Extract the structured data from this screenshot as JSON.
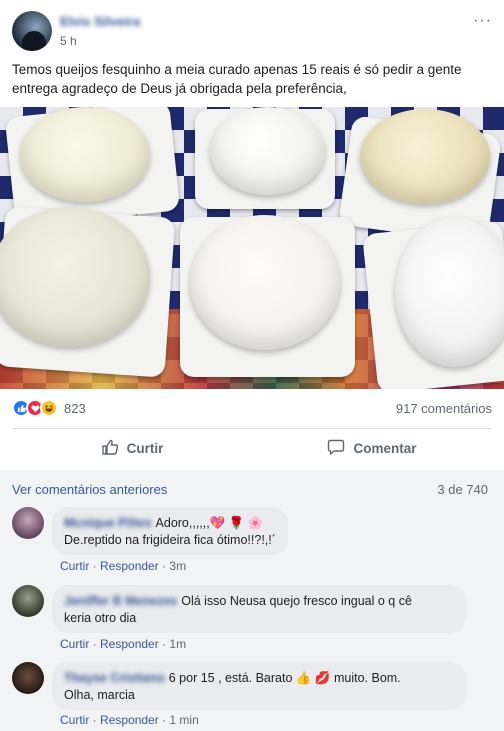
{
  "post": {
    "author_name": "Elvis Silveira",
    "time": "5 h",
    "menu_icon": "ellipsis-icon",
    "text": "Temos queijos fesquinho a meia curado apenas 15 reais é só pedir a gente entrega agradeço de Deus já obrigada pela preferência,"
  },
  "reactions": {
    "icons": [
      "like-icon",
      "love-icon",
      "haha-icon"
    ],
    "count": "823",
    "comments_count": "917 comentários"
  },
  "actions": {
    "like_label": "Curtir",
    "comment_label": "Comentar"
  },
  "comments_section": {
    "view_previous": "Ver comentários anteriores",
    "range": "3 de 740",
    "items": [
      {
        "author": "Mcnique Piltes",
        "text_line1": "Adoro,,,,,,💖 🌹 🌸",
        "text_line2": "De.reptido na frigideira fica ótimo!!?!,!´",
        "like": "Curtir",
        "reply": "Responder",
        "time": "3m"
      },
      {
        "author": "Jeniffer B Menezes",
        "text_line1": "Olá isso Neusa quejo fresco ingual o q cê",
        "text_line2": "keria otro dia",
        "like": "Curtir",
        "reply": "Responder",
        "time": "1m"
      },
      {
        "author": "Thayse Cristiano",
        "text_line1": "6 por 15 , está. Barato 👍 💋 muito. Bom.",
        "text_line2": "Olha, marcia",
        "like": "Curtir",
        "reply": "Responder",
        "time": "1 min"
      }
    ]
  }
}
